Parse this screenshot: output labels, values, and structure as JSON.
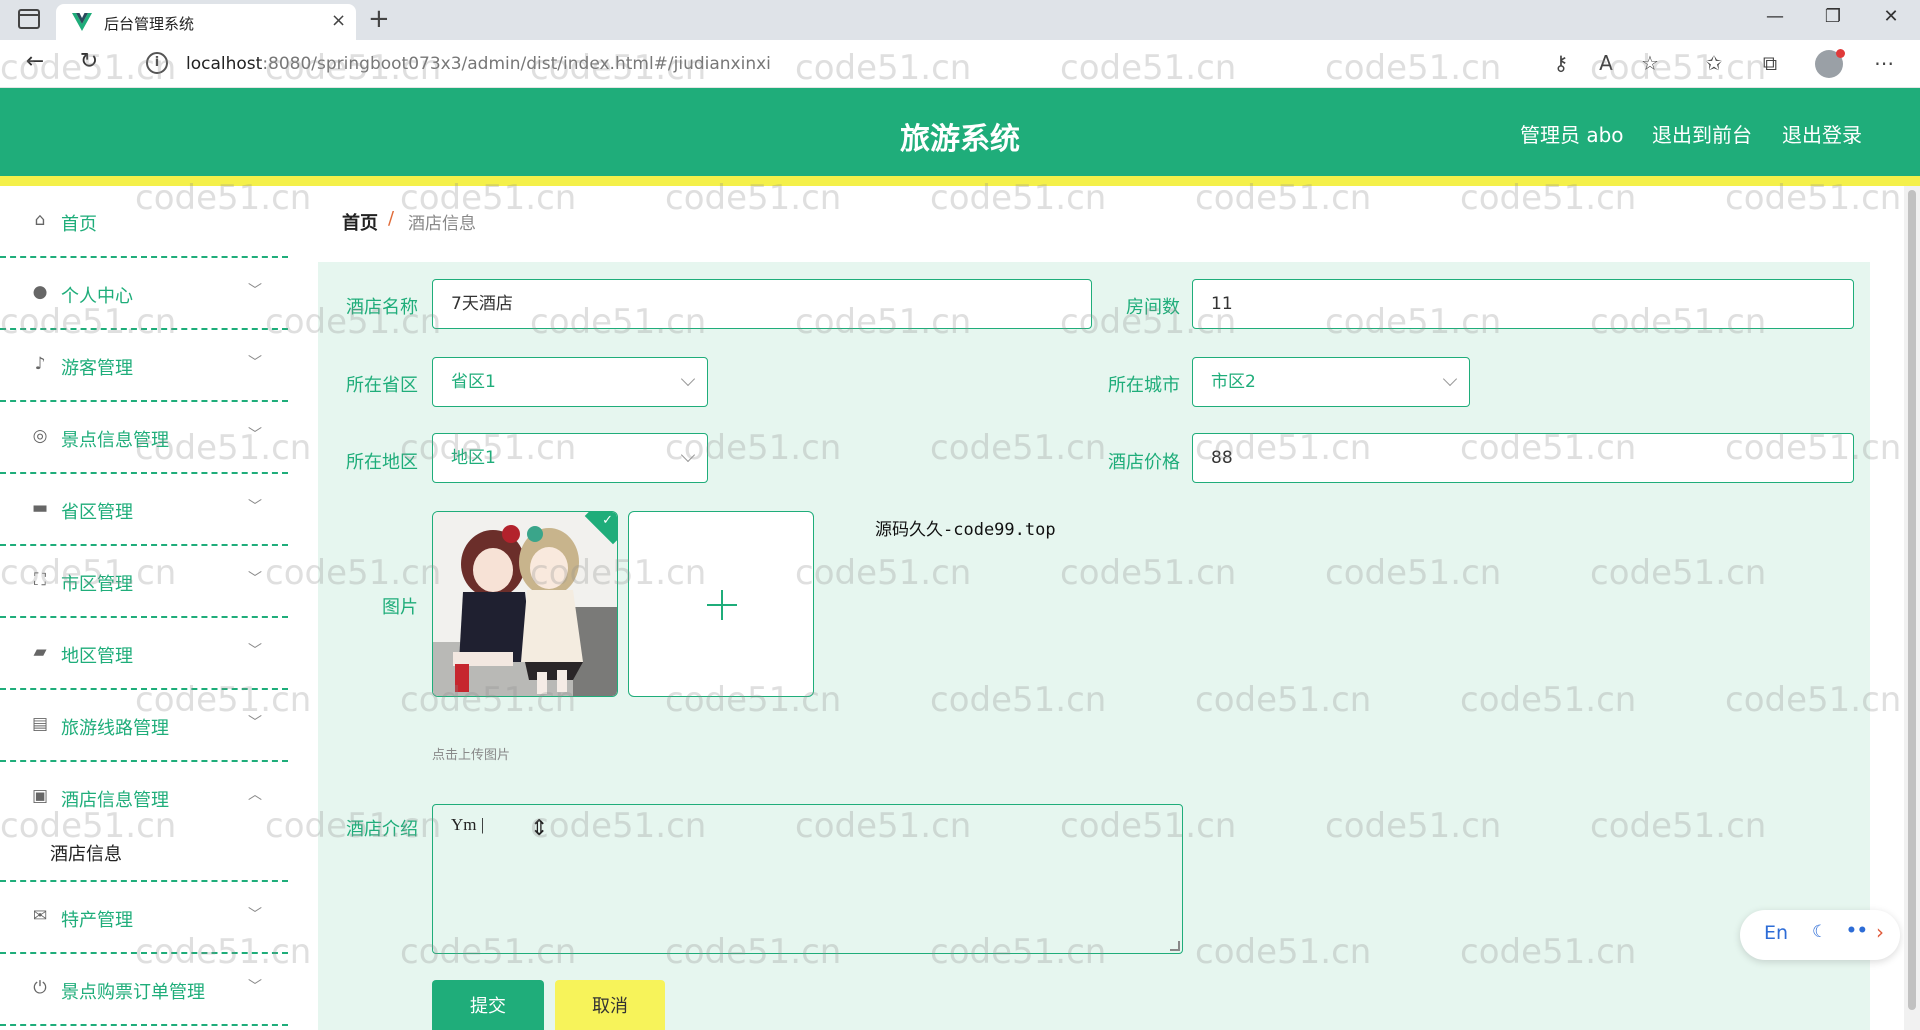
{
  "browser": {
    "tab_title": "后台管理系统",
    "tab_close": "×",
    "new_tab": "+",
    "url_host": "localhost",
    "url_rest": ":8080/springboot073x3/admin/dist/index.html#/jiudianxinxi",
    "win_min": "—",
    "win_restore": "❐",
    "win_close": "✕"
  },
  "header": {
    "title": "旅游系统",
    "user": "管理员 abo",
    "to_front": "退出到前台",
    "logout": "退出登录"
  },
  "sidebar": {
    "items": [
      {
        "label": "首页",
        "icon": "home-icon"
      },
      {
        "label": "个人中心",
        "icon": "user-icon"
      },
      {
        "label": "游客管理",
        "icon": "bell-icon"
      },
      {
        "label": "景点信息管理",
        "icon": "compass-icon"
      },
      {
        "label": "省区管理",
        "icon": "message-icon"
      },
      {
        "label": "市区管理",
        "icon": "fullscreen-icon"
      },
      {
        "label": "地区管理",
        "icon": "wallet-icon"
      },
      {
        "label": "旅游线路管理",
        "icon": "briefcase-icon"
      },
      {
        "label": "酒店信息管理",
        "icon": "clipboard-icon"
      },
      {
        "label": "特产管理",
        "icon": "mail-icon"
      },
      {
        "label": "景点购票订单管理",
        "icon": "power-icon"
      }
    ],
    "sub_item": "酒店信息"
  },
  "breadcrumb": {
    "home": "首页",
    "separator": "/",
    "current": "酒店信息"
  },
  "form": {
    "hotel_name_label": "酒店名称",
    "hotel_name_value": "7天酒店",
    "rooms_label": "房间数",
    "rooms_value": "11",
    "province_label": "所在省区",
    "province_value": "省区1",
    "city_label": "所在城市",
    "city_value": "市区2",
    "district_label": "所在地区",
    "district_value": "地区1",
    "price_label": "酒店价格",
    "price_value": "88",
    "image_label": "图片",
    "upload_tip": "点击上传图片",
    "source_note": "源码久久-code99.top",
    "intro_label": "酒店介绍",
    "intro_value": "Ym |",
    "submit": "提交",
    "cancel": "取消"
  },
  "lang_widget": {
    "lang": "En"
  },
  "watermark": "code51.cn",
  "colors": {
    "primary": "#1fad7a",
    "panel": "#e6f6ef",
    "accent_yellow": "#f4f04a"
  }
}
